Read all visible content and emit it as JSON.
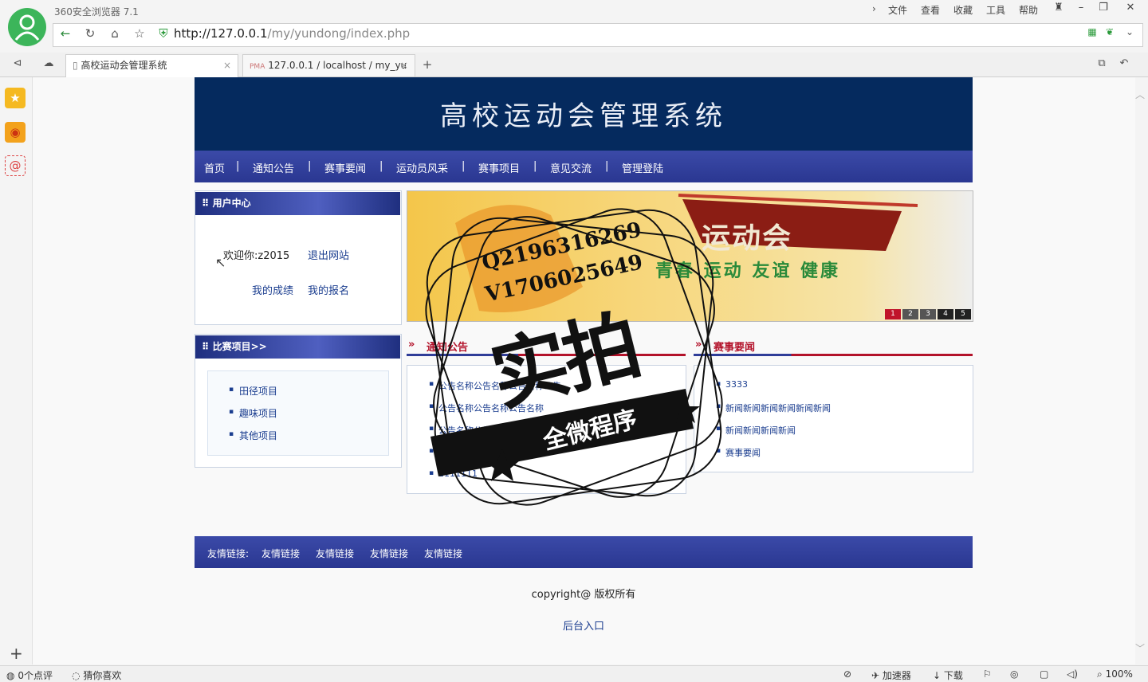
{
  "browser": {
    "app_title": "360安全浏览器 7.1",
    "menu": [
      "文件",
      "查看",
      "收藏",
      "工具",
      "帮助"
    ],
    "url_host": "http://127.0.0.1",
    "url_path": "/my/yundong/index.php",
    "tabs": [
      {
        "label": "高校运动会管理系统",
        "active": true
      },
      {
        "label": "127.0.0.1 / localhost / my_yu",
        "active": false
      }
    ],
    "status_left": [
      "0个点评",
      "猜你喜欢"
    ],
    "status_right": [
      "加速器",
      "下载",
      "100%"
    ]
  },
  "site": {
    "title": "高校运动会管理系统",
    "nav": [
      "首页",
      "通知公告",
      "赛事要闻",
      "运动员风采",
      "赛事项目",
      "意见交流",
      "管理登陆"
    ],
    "nav_sep": "|",
    "user_center": {
      "title": "用户中心",
      "welcome": "欢迎你:z2015",
      "logout": "退出网站",
      "my_scores": "我的成绩",
      "my_signup": "我的报名"
    },
    "events": {
      "title": "比赛项目>>",
      "items": [
        "田径项目",
        "趣味项目",
        "其他项目"
      ]
    },
    "banner": {
      "logo_text": "运动会",
      "slogan": "青春 运动 友谊 健康",
      "pages": [
        "1",
        "2",
        "3",
        "4",
        "5"
      ]
    },
    "notices": {
      "title": "通知公告",
      "items": [
        "公告名称公告名称公告名称公告",
        "公告名称公告名称公告名称",
        "公告名称公告名称公告名称",
        "公告名称公告名称",
        "1111111"
      ]
    },
    "news": {
      "title": "赛事要闻",
      "items": [
        "3333",
        "新闻新闻新闻新闻新闻新闻",
        "新闻新闻新闻新闻",
        "赛事要闻"
      ]
    },
    "friend_links": {
      "label": "友情链接:",
      "items": [
        "友情链接",
        "友情链接",
        "友情链接",
        "友情链接"
      ]
    },
    "copyright": "copyright@ 版权所有",
    "admin_entry": "后台入口"
  },
  "watermark": {
    "qq": "Q2196316269",
    "vx": "V1706025649",
    "big": "实拍",
    "sub": "全微程序"
  },
  "colors": {
    "header_bg": "#052a5e",
    "nav_bg": "#2f3d98",
    "section_red": "#b3122a",
    "link_blue": "#1a3d8f"
  }
}
